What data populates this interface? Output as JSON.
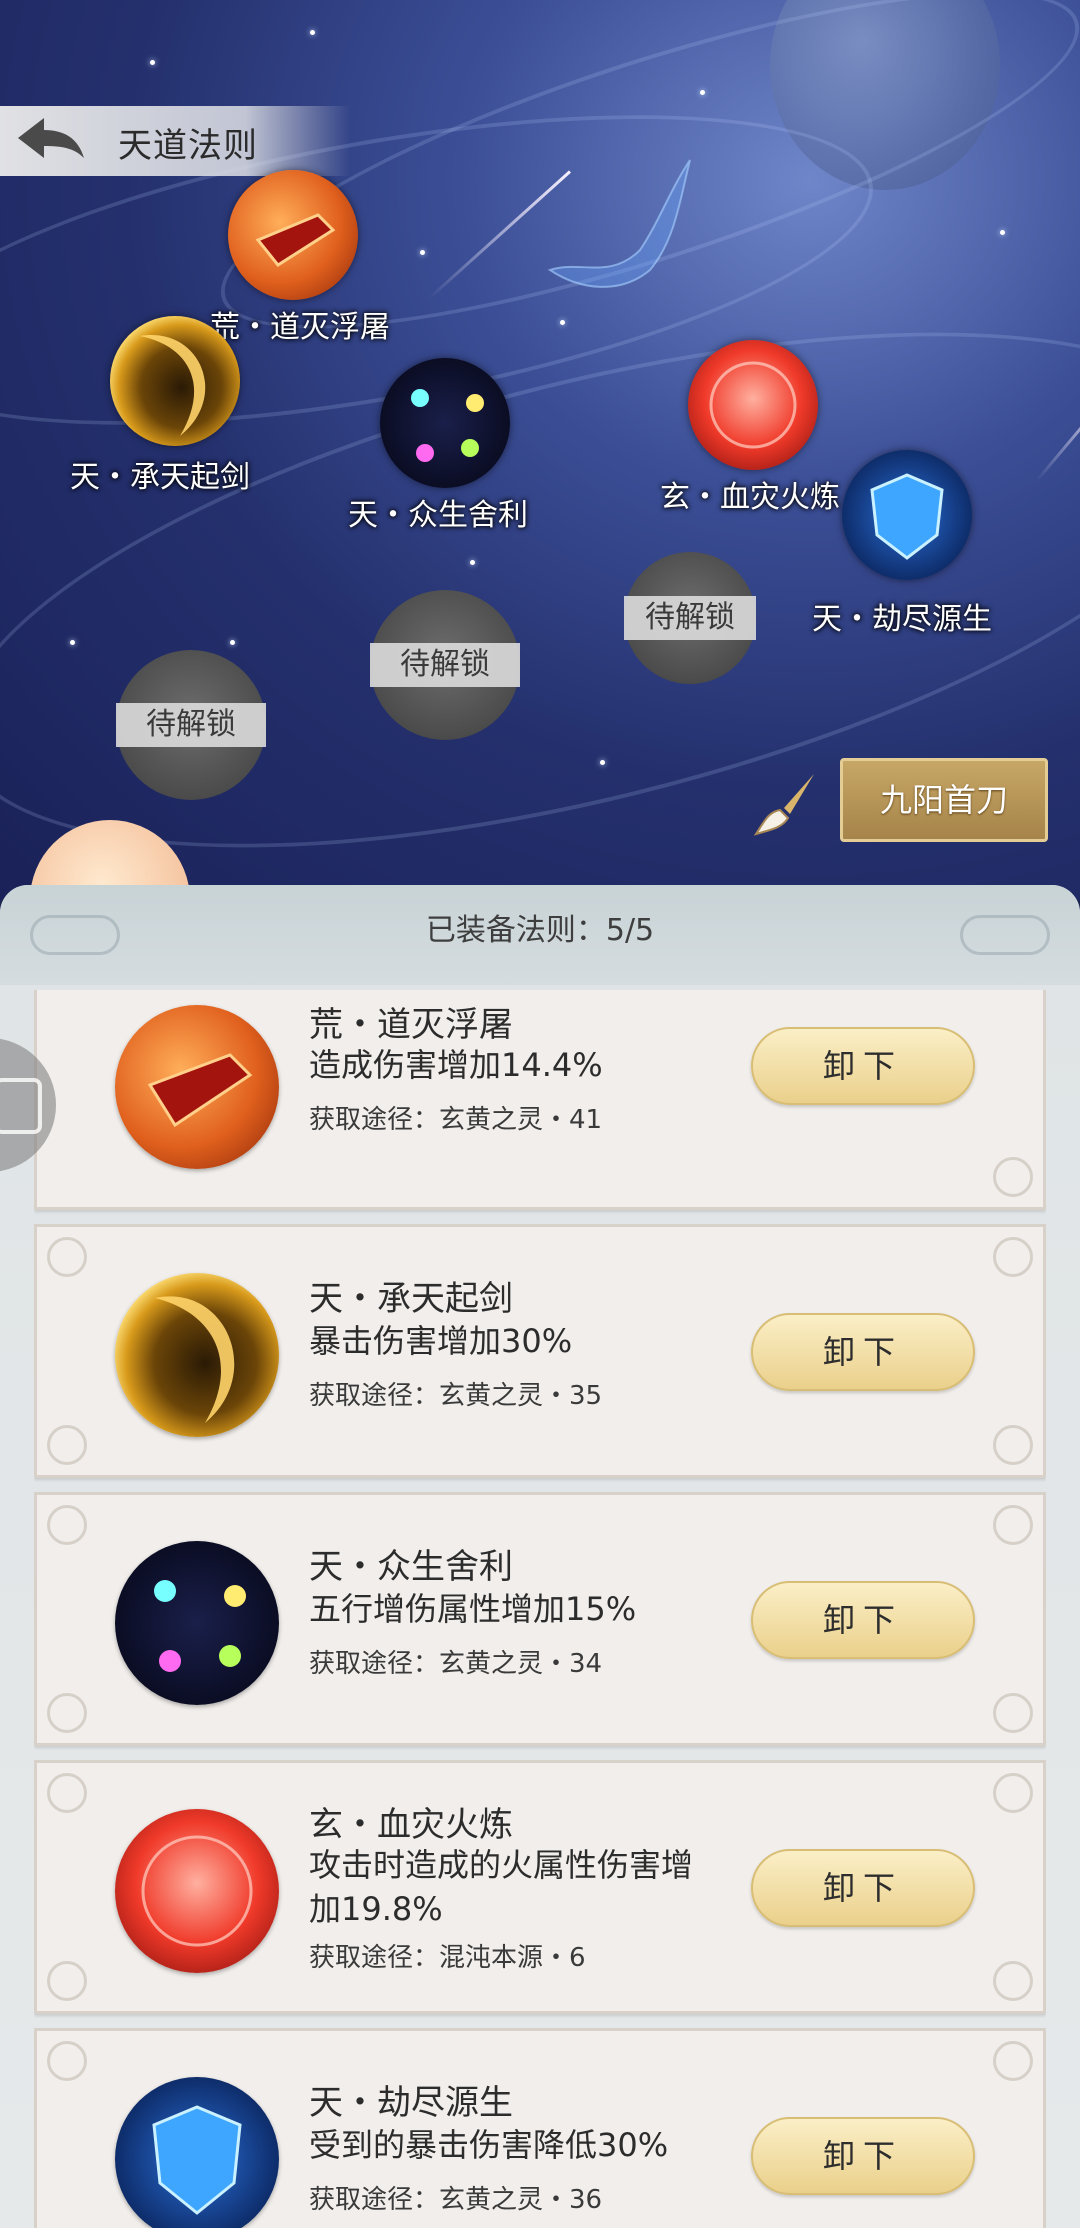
{
  "header": {
    "title": "天道法则"
  },
  "sky_nodes": [
    {
      "name": "荒・道灭浮屠",
      "icon": "fire-pagoda-icon"
    },
    {
      "name": "天・承天起剑",
      "icon": "golden-crescent-icon"
    },
    {
      "name": "天・众生舍利",
      "icon": "colored-comets-icon"
    },
    {
      "name": "玄・血灾火炼",
      "icon": "red-orb-icon"
    },
    {
      "name": "天・劫尽源生",
      "icon": "blue-shield-icon"
    }
  ],
  "locked_nodes": [
    "待解锁",
    "待解锁",
    "待解锁"
  ],
  "nine_button": "九阳首刀",
  "panel": {
    "equipped": "已装备法则：5/5"
  },
  "cards": [
    {
      "name": "荒・道灭浮屠",
      "effect": "造成伤害增加14.4%",
      "source": "获取途径：玄黄之灵・41",
      "button": "卸下"
    },
    {
      "name": "天・承天起剑",
      "effect": "暴击伤害增加30%",
      "source": "获取途径：玄黄之灵・35",
      "button": "卸下"
    },
    {
      "name": "天・众生舍利",
      "effect": "五行增伤属性增加15%",
      "source": "获取途径：玄黄之灵・34",
      "button": "卸下"
    },
    {
      "name": "玄・血灾火炼",
      "effect": "攻击时造成的火属性伤害增加19.8%",
      "source": "获取途径：混沌本源・6",
      "button": "卸下"
    },
    {
      "name": "天・劫尽源生",
      "effect": "受到的暴击伤害降低30%",
      "source": "获取途径：玄黄之灵・36",
      "button": "卸下"
    }
  ],
  "colors": {
    "accent_gold": "#c7a766",
    "button_cream": "#f3e2a8",
    "panel_bg": "#e3e7e9"
  }
}
